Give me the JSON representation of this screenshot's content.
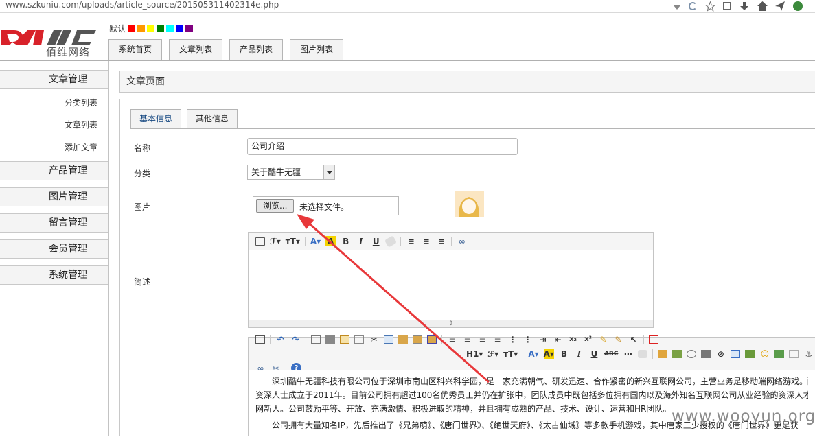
{
  "browser": {
    "url": "www.szkuniu.com/uploads/article_source/201505311402314e.php"
  },
  "header": {
    "logo_text": "佰维网络",
    "theme_label": "默认",
    "theme_colors": [
      "#ff0000",
      "#ff9900",
      "#ffff00",
      "#008000",
      "#00ffff",
      "#0000ff",
      "#800080"
    ],
    "tabs": [
      "系统首页",
      "文章列表",
      "产品列表",
      "图片列表"
    ]
  },
  "sidebar": {
    "groups": [
      "文章管理",
      "产品管理",
      "图片管理",
      "留言管理",
      "会员管理",
      "系统管理"
    ],
    "article_items": [
      "分类列表",
      "文章列表",
      "添加文章"
    ]
  },
  "main": {
    "page_title": "文章页面",
    "tabs": [
      "基本信息",
      "其他信息"
    ],
    "labels": {
      "name": "名称",
      "category": "分类",
      "image": "图片",
      "summary": "简述"
    },
    "name_value": "公司介绍",
    "category_value": "关于酷牛无疆",
    "browse_button": "浏览...",
    "file_status": "未选择文件。",
    "content_paragraphs": [
      "深圳酷牛无疆科技有限公司位于深圳市南山区科兴科学园，是一家充满朝气、研发迅速、合作紧密的新兴互联网公司，主营业务是移动端网络游戏。酷牛",
      "资深人士成立于2011年。目前公司拥有超过100名优秀员工并仍在扩张中，团队成员中既包括多位拥有国内以及海外知名互联网公司从业经验的资深人才，也",
      "网新人。公司鼓励平等、开放、充满激情、积极进取的精神，并且拥有成熟的产品、技术、设计、运营和HR团队。",
      "公司拥有大量知名IP，先后推出了《兄弟萌》、《唐门世界》、《绝世天府》、《太古仙域》等多款手机游戏，其中唐家三少授权的《唐门世界》更是获"
    ]
  },
  "watermark": "www.wooyun.org"
}
